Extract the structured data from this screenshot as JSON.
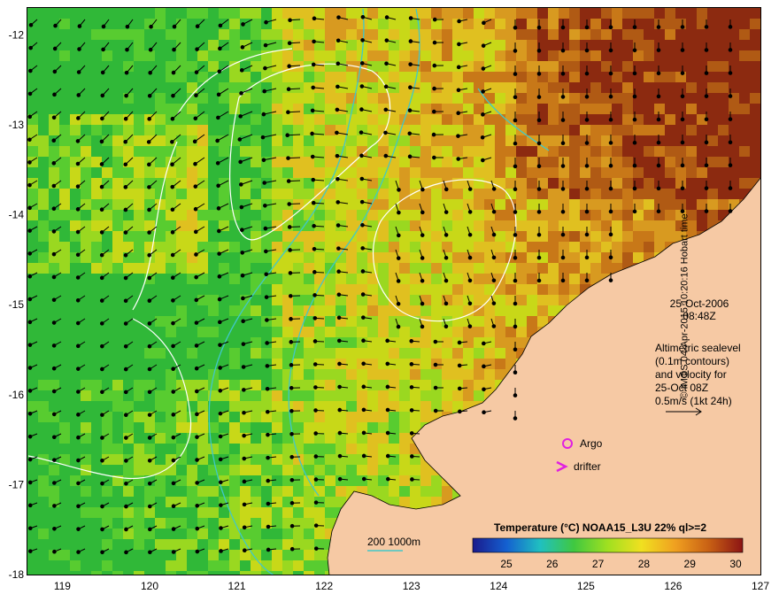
{
  "map": {
    "lon_range": [
      118.6,
      127
    ],
    "lat_range": [
      -18,
      -11.7
    ],
    "x_ticks": [
      119,
      120,
      121,
      122,
      123,
      124,
      125,
      126,
      127
    ],
    "y_ticks": [
      -12,
      -13,
      -14,
      -15,
      -16,
      -17,
      -18
    ],
    "date_line1": "25-Oct-2006",
    "date_line2": "08:48Z",
    "info_lines": [
      "Altimetric sealevel",
      "(0.1m contours)",
      "and velocity for",
      "25-Oct 08Z",
      "0.5m/s (1kt 24h)"
    ],
    "argo_label": "Argo",
    "drifter_label": "drifter",
    "depth_label": "200  1000m",
    "credit": "© IMOS 04-Apr-2015 10:20:16 Hobart time",
    "colors": {
      "land": "#f6c9a4",
      "argo": "#e020e0",
      "drifter": "#e020e0",
      "isobath": "#40c8c8",
      "contour": "#ffffff"
    }
  },
  "colorbar": {
    "title": "Temperature (°C) NOAA15_L3U 22% ql>=2",
    "ticks": [
      "25",
      "26",
      "27",
      "28",
      "29",
      "30"
    ],
    "stops": [
      "#1a1a8c",
      "#1460d0",
      "#20c0c0",
      "#40c840",
      "#a0e020",
      "#f0e020",
      "#f0a020",
      "#c86014",
      "#8c1414"
    ]
  }
}
